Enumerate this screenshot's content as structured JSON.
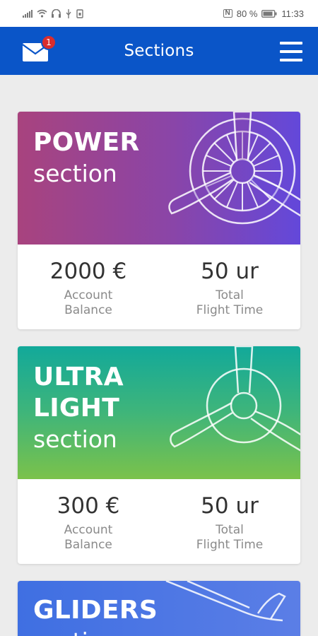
{
  "status_bar": {
    "left_icons": [
      "signal-icon",
      "wifi-icon",
      "headset-icon",
      "usb-icon",
      "sim-icon"
    ],
    "battery_text": "80 %",
    "time": "11:33",
    "nfc": "N"
  },
  "app_bar": {
    "title": "Sections",
    "mail_badge": "1"
  },
  "colors": {
    "app_bar": "#0a55c8",
    "power_gradient_start": "#a8437e",
    "power_gradient_end": "#6348da",
    "ultralight_gradient_start": "#12a99a",
    "ultralight_gradient_end": "#7bc24a",
    "gliders_gradient_start": "#3f6fe2",
    "gliders_gradient_end": "#5b7ee6"
  },
  "sections": [
    {
      "title_lines": [
        "POWER"
      ],
      "subtitle": "section",
      "balance_value": "2000 €",
      "balance_label_1": "Account",
      "balance_label_2": "Balance",
      "time_value": "50 ur",
      "time_label_1": "Total",
      "time_label_2": "Flight Time",
      "icon": "radial-engine-propeller-icon"
    },
    {
      "title_lines": [
        "ULTRA",
        "LIGHT"
      ],
      "subtitle": "section",
      "balance_value": "300 €",
      "balance_label_1": "Account",
      "balance_label_2": "Balance",
      "time_value": "50 ur",
      "time_label_1": "Total",
      "time_label_2": "Flight Time",
      "icon": "propeller-icon"
    },
    {
      "title_lines": [
        "GLIDERS"
      ],
      "subtitle": "section",
      "icon": "glider-icon"
    }
  ]
}
